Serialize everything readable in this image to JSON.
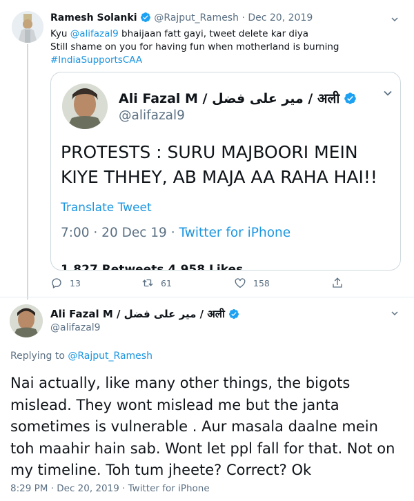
{
  "top_tweet": {
    "name": "Ramesh Solanki",
    "handle": "@Rajput_Ramesh",
    "separator": "·",
    "date": "Dec 20, 2019",
    "text_prefix": "Kyu ",
    "mention": "@alifazal9",
    "text_line1_rest": " bhaijaan fatt gayi, tweet delete kar diya",
    "text_line2": "Still shame on you for having fun when motherland is burning",
    "hashtag": "#IndiaSupportsCAA"
  },
  "quoted_tweet": {
    "name": "Ali Fazal M / میر علی فضل / अली",
    "handle": "@alifazal9",
    "text": "PROTESTS : SURU MAJBOORI MEIN KIYE THHEY, AB MAJA AA RAHA HAI!!",
    "translate_label": "Translate Tweet",
    "time": "7:00 · 20 Dec 19 · ",
    "source": "Twitter for iPhone",
    "stats_partial": "1,827 Retweets  4,958 Likes"
  },
  "actions": {
    "reply_count": "13",
    "retweet_count": "61",
    "like_count": "158"
  },
  "reply_tweet": {
    "name": "Ali Fazal M / میر علی فضل / अली",
    "handle": "@alifazal9",
    "replying_label": "Replying to ",
    "replying_to": "@Rajput_Ramesh",
    "text": "Nai actually, like many other things, the bigots mislead. They wont mislead me but the janta sometimes is vulnerable . Aur masala daalne mein toh maahir hain sab. Wont let ppl fall for that. Not on my timeline. Toh tum jheete? Correct? Ok",
    "meta": "8:29 PM · Dec 20, 2019 · Twitter for iPhone"
  },
  "colors": {
    "accent": "#1b95e0",
    "secondary_text": "#5b7083",
    "border": "#cfd9de"
  },
  "icons": [
    "verified-badge-icon",
    "chevron-down-icon",
    "reply-icon",
    "retweet-icon",
    "like-icon",
    "share-icon"
  ]
}
